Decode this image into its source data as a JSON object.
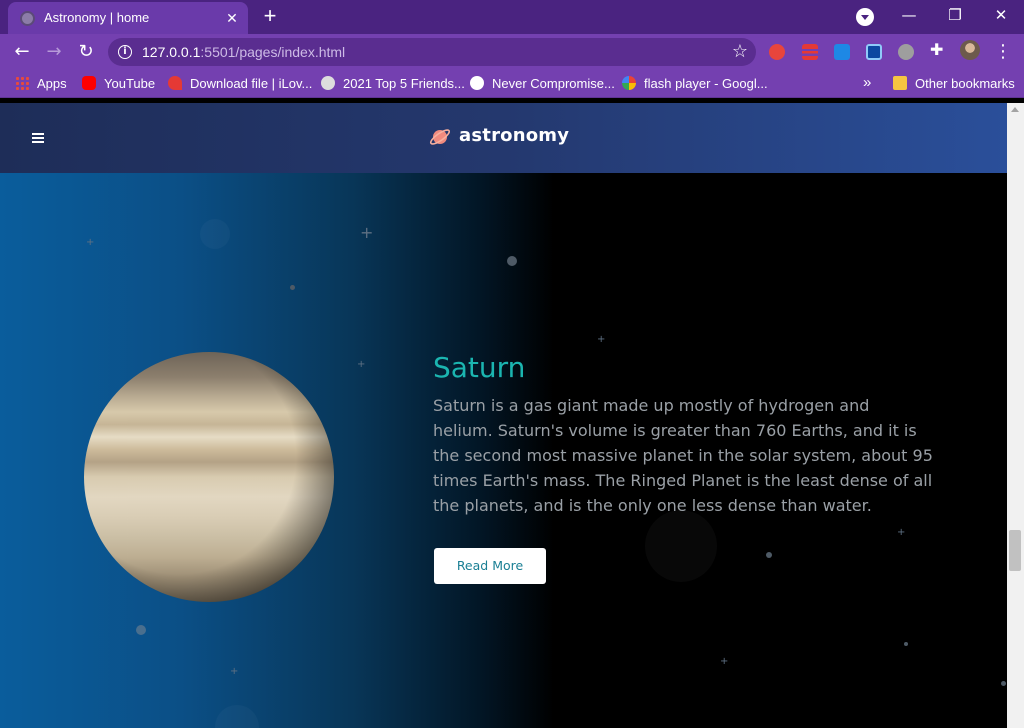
{
  "browser": {
    "tab": {
      "title": "Astronomy | home",
      "close": "✕",
      "favicon": "globe-icon"
    },
    "new_tab": "+",
    "window_controls": {
      "minimize": "—",
      "maximize": "❐",
      "close": "✕"
    },
    "nav": {
      "back": "←",
      "forward": "→",
      "reload": "↻"
    },
    "address": {
      "host": "127.0.0.1",
      "path": ":5501/pages/index.html",
      "info": "i"
    },
    "bookmark_star": "☆",
    "menu": "⋮",
    "extensions": [
      "infinity-extension-icon",
      "stack-extension-icon",
      "cloud-extension-icon",
      "screen-extension-icon",
      "globe-extension-icon",
      "puzzle-icon",
      "profile-avatar"
    ],
    "bookmarks": [
      {
        "label": "Apps",
        "icon": "apps-grid-icon",
        "color": "#e84a3c"
      },
      {
        "label": "YouTube",
        "icon": "youtube-icon",
        "color": "#ff0000"
      },
      {
        "label": "Download file | iLov...",
        "icon": "heart-icon",
        "color": "#e53935"
      },
      {
        "label": "2021 Top 5 Friends...",
        "icon": "globe-icon",
        "color": "#dddddd"
      },
      {
        "label": "Never Compromise...",
        "icon": "shield-icon",
        "color": "#ffffff"
      },
      {
        "label": "flash player - Googl...",
        "icon": "google-icon",
        "color": "#ffffff"
      }
    ],
    "bookmarks_overflow": "»",
    "other_bookmarks": "Other bookmarks"
  },
  "site": {
    "brand": "astronomy",
    "menu_icon": "hamburger-icon"
  },
  "hero": {
    "title": "Saturn",
    "description": "Saturn is a gas giant made up mostly of hydrogen and helium. Saturn's volume is greater than 760 Earths, and it is the second most massive planet in the solar system, about 95 times Earth's mass. The Ringed Planet is the least dense of all the planets, and is the only one less dense than water.",
    "cta": "Read More"
  },
  "colors": {
    "title_accent": "#1bb5b0",
    "button_text": "#1a7f94",
    "header_start": "#1e2d58",
    "header_end": "#2a4f9a",
    "browser_chrome": "#7440b0"
  }
}
